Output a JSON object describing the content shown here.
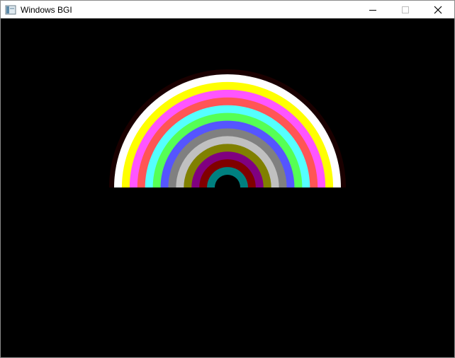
{
  "window": {
    "title": "Windows BGI"
  },
  "titlebar_buttons": [
    {
      "name": "minimize-button",
      "icon": "minimize-icon"
    },
    {
      "name": "maximize-button",
      "icon": "maximize-icon"
    },
    {
      "name": "close-button",
      "icon": "close-icon"
    }
  ],
  "canvas": {
    "background": "#000000",
    "rainbow_bands": [
      {
        "color": "#FFFFFF"
      },
      {
        "color": "#FFFF00"
      },
      {
        "color": "#FF55FF"
      },
      {
        "color": "#FF5555"
      },
      {
        "color": "#55FFFF"
      },
      {
        "color": "#55FF55"
      },
      {
        "color": "#5555FF"
      },
      {
        "color": "#808080"
      },
      {
        "color": "#C0C0C0"
      },
      {
        "color": "#808000"
      },
      {
        "color": "#800080"
      },
      {
        "color": "#800000"
      },
      {
        "color": "#008080"
      }
    ],
    "outer_ring_color": "#1a0000",
    "inner_hole_color": "#000000"
  }
}
